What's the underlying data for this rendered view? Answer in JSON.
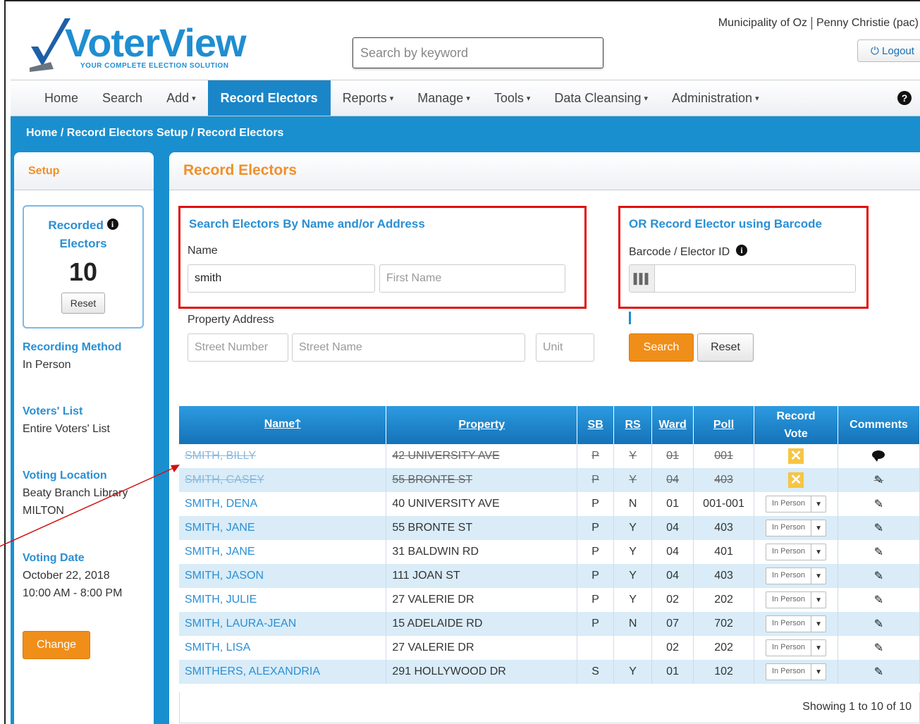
{
  "header": {
    "logo_text": "VoterView",
    "logo_tagline": "YOUR COMPLETE ELECTION SOLUTION",
    "search_placeholder": "Search by keyword",
    "municipality": "Municipality of Oz",
    "user": "Penny Christie (pac)",
    "logout_label": "Logout"
  },
  "nav": {
    "items": [
      {
        "label": "Home",
        "dropdown": false
      },
      {
        "label": "Search",
        "dropdown": false
      },
      {
        "label": "Add",
        "dropdown": true
      },
      {
        "label": "Record Electors",
        "dropdown": false,
        "active": true
      },
      {
        "label": "Reports",
        "dropdown": true
      },
      {
        "label": "Manage",
        "dropdown": true
      },
      {
        "label": "Tools",
        "dropdown": true
      },
      {
        "label": "Data Cleansing",
        "dropdown": true
      },
      {
        "label": "Administration",
        "dropdown": true
      }
    ],
    "help_icon": "?"
  },
  "breadcrumb": "Home / Record Electors Setup / Record Electors",
  "sidebar": {
    "title": "Setup",
    "recorded_label_1": "Recorded",
    "recorded_label_2": "Electors",
    "recorded_count": "10",
    "reset_label": "Reset",
    "recording_method_title": "Recording Method",
    "recording_method_value": "In Person",
    "voters_list_title": "Voters' List",
    "voters_list_value": "Entire Voters' List",
    "voting_location_title": "Voting Location",
    "voting_location_line1": "Beaty Branch Library",
    "voting_location_line2": "MILTON",
    "voting_date_title": "Voting Date",
    "voting_date_value": "October 22, 2018",
    "voting_time_value": "10:00 AM - 8:00 PM",
    "change_label": "Change"
  },
  "main": {
    "title": "Record Electors",
    "search_section_title": "Search Electors By Name and/or Address",
    "name_label": "Name",
    "last_name_value": "smith",
    "first_name_placeholder": "First Name",
    "property_label": "Property Address",
    "street_number_placeholder": "Street Number",
    "street_name_placeholder": "Street Name",
    "unit_placeholder": "Unit",
    "barcode_section_title": "OR Record Elector using Barcode",
    "barcode_label": "Barcode / Elector ID",
    "barcode_value": "",
    "search_label": "Search",
    "reset_label": "Reset"
  },
  "table": {
    "headers": [
      "Name",
      "Property",
      "SB",
      "RS",
      "Ward",
      "Poll",
      "Record Vote",
      "Comments"
    ],
    "sort_indicator": "🡑",
    "record_vote_line1": "Record",
    "record_vote_line2": "Vote",
    "select_value": "In Person",
    "rows": [
      {
        "name": "SMITH, BILLY",
        "property": "42 UNIVERSITY AVE",
        "sb": "P",
        "rs": "Y",
        "ward": "01",
        "poll": "001",
        "recorded": true,
        "comment": "bubble"
      },
      {
        "name": "SMITH, CASEY",
        "property": "55 BRONTE ST",
        "sb": "P",
        "rs": "Y",
        "ward": "04",
        "poll": "403",
        "recorded": true,
        "comment": "pencil"
      },
      {
        "name": "SMITH, DENA",
        "property": "40 UNIVERSITY AVE",
        "sb": "P",
        "rs": "N",
        "ward": "01",
        "poll": "001-001",
        "recorded": false,
        "comment": "pencil"
      },
      {
        "name": "SMITH, JANE",
        "property": "55 BRONTE ST",
        "sb": "P",
        "rs": "Y",
        "ward": "04",
        "poll": "403",
        "recorded": false,
        "comment": "pencil"
      },
      {
        "name": "SMITH, JANE",
        "property": "31 BALDWIN RD",
        "sb": "P",
        "rs": "Y",
        "ward": "04",
        "poll": "401",
        "recorded": false,
        "comment": "pencil"
      },
      {
        "name": "SMITH, JASON",
        "property": "111 JOAN ST",
        "sb": "P",
        "rs": "Y",
        "ward": "04",
        "poll": "403",
        "recorded": false,
        "comment": "pencil"
      },
      {
        "name": "SMITH, JULIE",
        "property": "27 VALERIE DR",
        "sb": "P",
        "rs": "Y",
        "ward": "02",
        "poll": "202",
        "recorded": false,
        "comment": "pencil"
      },
      {
        "name": "SMITH, LAURA-JEAN",
        "property": "15 ADELAIDE RD",
        "sb": "P",
        "rs": "N",
        "ward": "07",
        "poll": "702",
        "recorded": false,
        "comment": "pencil"
      },
      {
        "name": "SMITH, LISA",
        "property": "27 VALERIE DR",
        "sb": "",
        "rs": "",
        "ward": "02",
        "poll": "202",
        "recorded": false,
        "comment": "pencil"
      },
      {
        "name": "SMITHERS, ALEXANDRIA",
        "property": "291 HOLLYWOOD DR",
        "sb": "S",
        "rs": "Y",
        "ward": "01",
        "poll": "102",
        "recorded": false,
        "comment": "pencil"
      }
    ],
    "showing": "Showing 1 to 10 of 10"
  },
  "colors": {
    "accent_blue": "#1a8fd0",
    "accent_orange": "#f08e1a",
    "highlight_red": "#e01010"
  }
}
